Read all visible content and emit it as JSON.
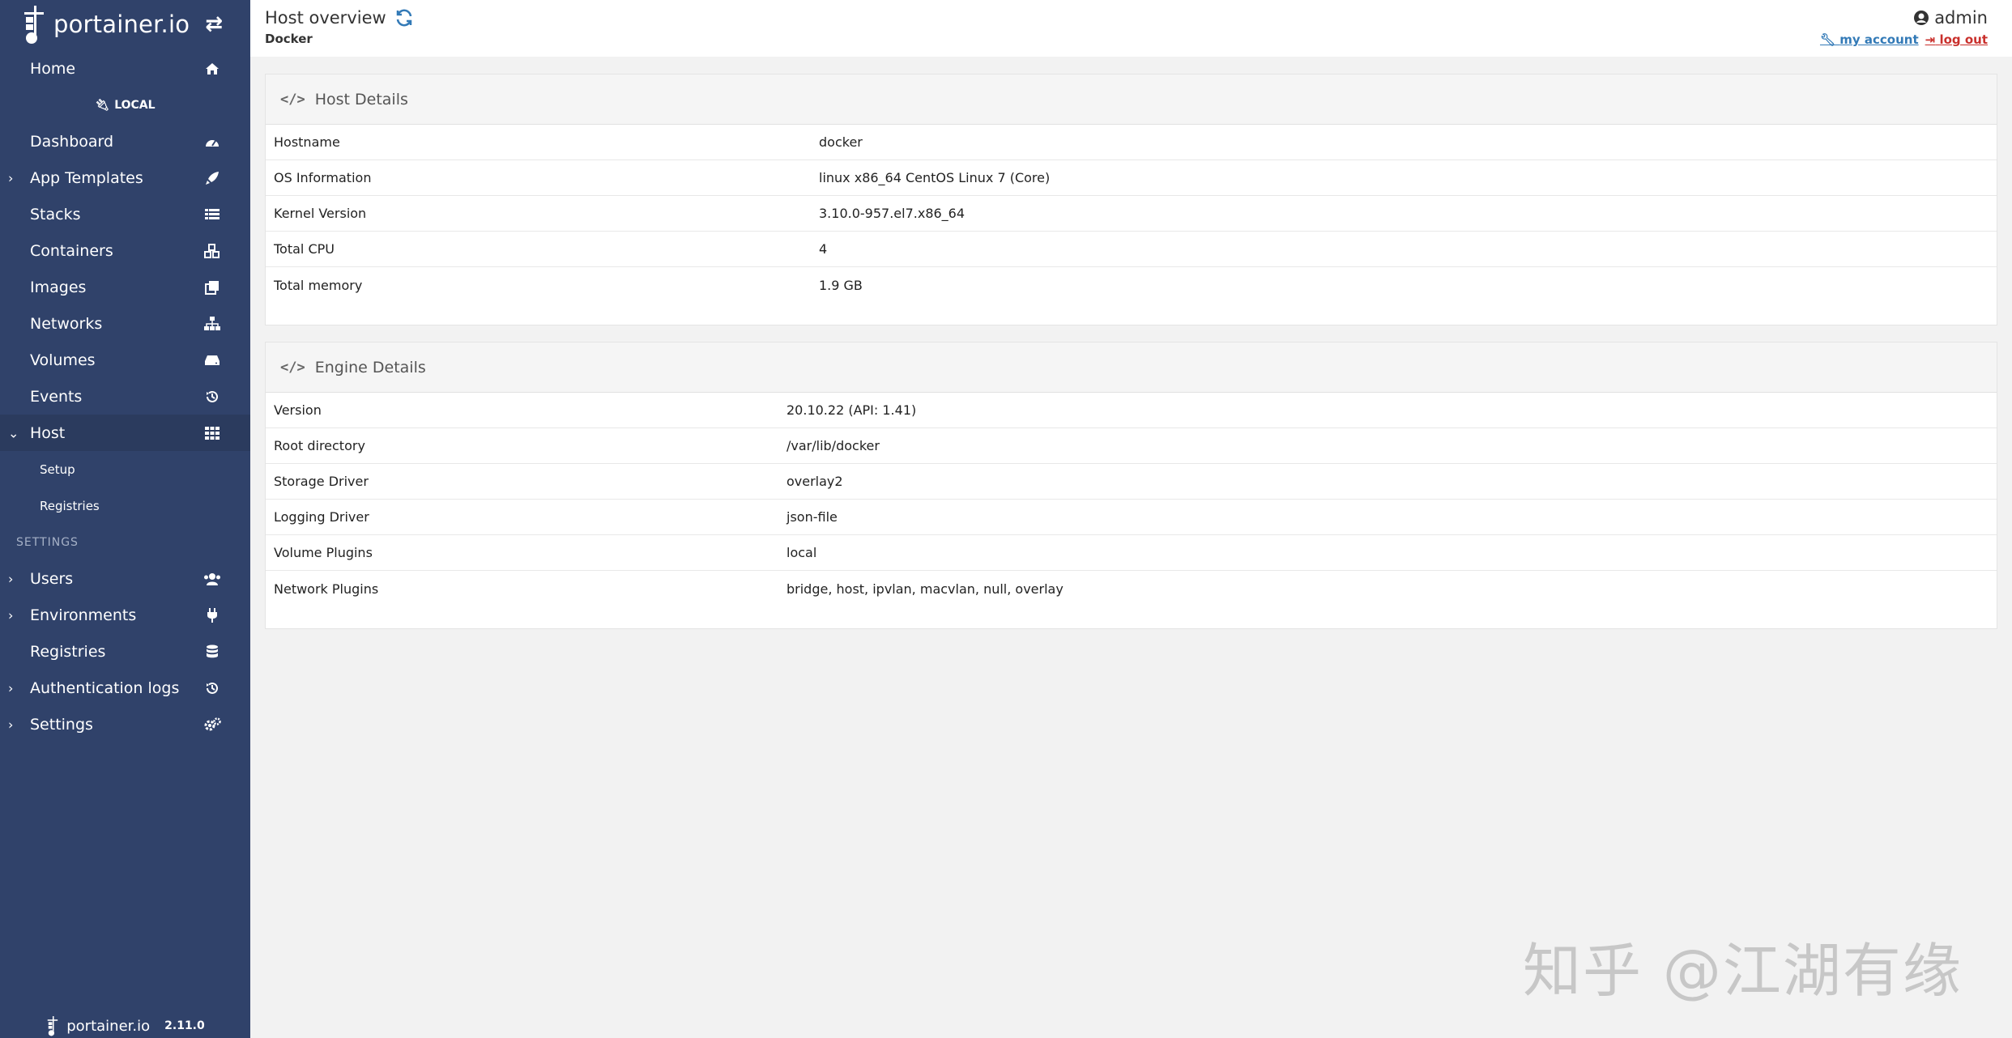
{
  "sidebar": {
    "brand": "portainer.io",
    "home": "Home",
    "environment": "LOCAL",
    "items": [
      {
        "label": "Dashboard"
      },
      {
        "label": "App Templates"
      },
      {
        "label": "Stacks"
      },
      {
        "label": "Containers"
      },
      {
        "label": "Images"
      },
      {
        "label": "Networks"
      },
      {
        "label": "Volumes"
      },
      {
        "label": "Events"
      },
      {
        "label": "Host"
      }
    ],
    "host_sub": [
      {
        "label": "Setup"
      },
      {
        "label": "Registries"
      }
    ],
    "settings_heading": "SETTINGS",
    "settings_items": [
      {
        "label": "Users"
      },
      {
        "label": "Environments"
      },
      {
        "label": "Registries"
      },
      {
        "label": "Authentication logs"
      },
      {
        "label": "Settings"
      }
    ],
    "footer_brand": "portainer.io",
    "version": "2.11.0"
  },
  "header": {
    "title": "Host overview",
    "breadcrumb": "Docker",
    "username": "admin",
    "my_account": "my account",
    "log_out": "log out"
  },
  "host_details": {
    "title": "Host Details",
    "rows": [
      {
        "key": "Hostname",
        "value": "docker"
      },
      {
        "key": "OS Information",
        "value": "linux x86_64 CentOS Linux 7 (Core)"
      },
      {
        "key": "Kernel Version",
        "value": "3.10.0-957.el7.x86_64"
      },
      {
        "key": "Total CPU",
        "value": "4"
      },
      {
        "key": "Total memory",
        "value": "1.9 GB"
      }
    ]
  },
  "engine_details": {
    "title": "Engine Details",
    "rows": [
      {
        "key": "Version",
        "value": "20.10.22 (API: 1.41)"
      },
      {
        "key": "Root directory",
        "value": "/var/lib/docker"
      },
      {
        "key": "Storage Driver",
        "value": "overlay2"
      },
      {
        "key": "Logging Driver",
        "value": "json-file"
      },
      {
        "key": "Volume Plugins",
        "value": "local"
      },
      {
        "key": "Network Plugins",
        "value": "bridge, host, ipvlan, macvlan, null, overlay"
      }
    ]
  },
  "watermark": "知乎 @江湖有缘",
  "colors": {
    "sidebar_bg": "#30426a",
    "link": "#337ab7",
    "logout": "#c9302c"
  }
}
